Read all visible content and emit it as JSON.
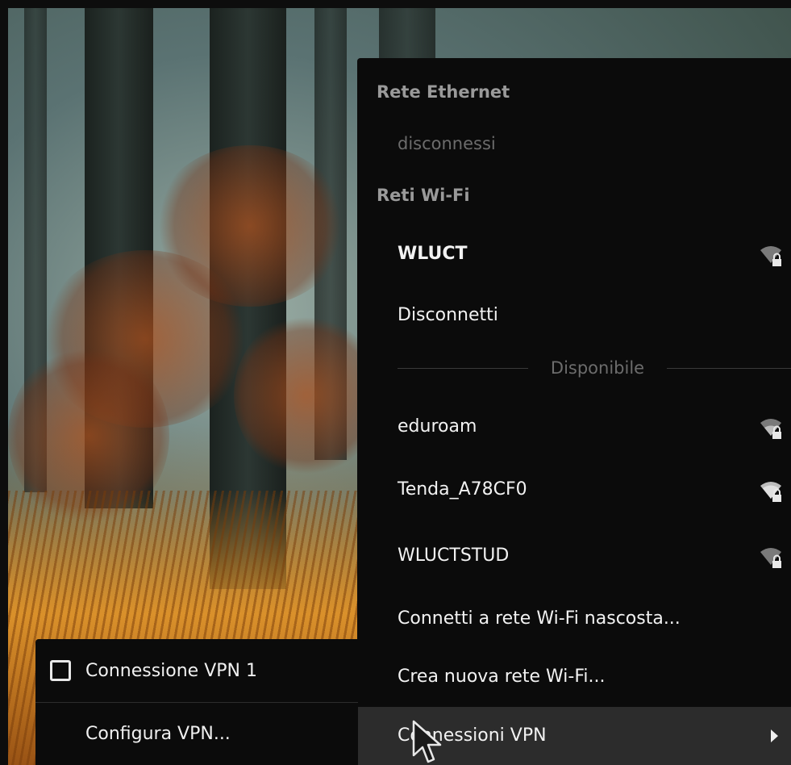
{
  "menu": {
    "ethernet_header": "Rete Ethernet",
    "ethernet_status": "disconnessi",
    "wifi_header": "Reti Wi-Fi",
    "connected_network": "WLUCT",
    "disconnect": "Disconnetti",
    "available_label": "Disponibile",
    "networks": [
      {
        "name": "eduroam",
        "icon": "wifi-signal-secured-icon"
      },
      {
        "name": "Tenda_A78CF0",
        "icon": "wifi-signal-secured-icon"
      },
      {
        "name": "WLUCTSTUD",
        "icon": "wifi-signal-secured-icon"
      }
    ],
    "connect_hidden": "Connetti a rete Wi-Fi nascosta...",
    "create_new": "Crea nuova rete Wi-Fi...",
    "vpn_connections": "Connessioni VPN"
  },
  "vpn_submenu": {
    "vpn1": "Connessione VPN 1",
    "vpn1_checked": false,
    "configure": "Configura VPN..."
  },
  "colors": {
    "menu_bg": "#0b0b0b",
    "highlight_bg": "#2c2c2c",
    "header_text": "#9a9a9a",
    "dim_text": "#6c6c6c",
    "item_text": "#f2f2f2"
  }
}
